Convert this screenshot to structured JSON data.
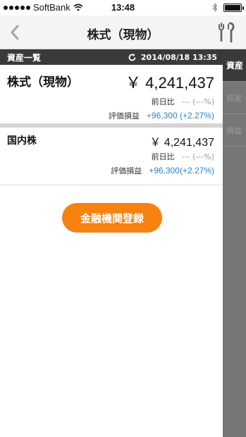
{
  "status_bar": {
    "carrier": "SoftBank",
    "time": "13:48"
  },
  "nav": {
    "title": "株式（現物）"
  },
  "section": {
    "title": "資産一覧",
    "timestamp": "2014/08/18 13:35"
  },
  "summary": {
    "name": "株式（現物）",
    "amount": "￥ 4,241,437",
    "prev_day_label": "前日比",
    "prev_day_value": "--- (---%)",
    "gain_label": "評価損益",
    "gain_value": "+96,300 (+2.27%)"
  },
  "domestic": {
    "name": "国内株",
    "amount": "￥ 4,241,437",
    "prev_day_label": "前日比",
    "prev_day_value": "--- (---%)",
    "gain_label": "評価損益",
    "gain_value": "+96,300(+2.27%)"
  },
  "register_button": "金融機関登録",
  "side_tabs": [
    {
      "label": "資産"
    },
    {
      "label": "資産"
    },
    {
      "label": "損益"
    }
  ],
  "colors": {
    "accent": "#f7820f",
    "gain": "#2a84c8",
    "header_bg": "#3a3a3a"
  }
}
